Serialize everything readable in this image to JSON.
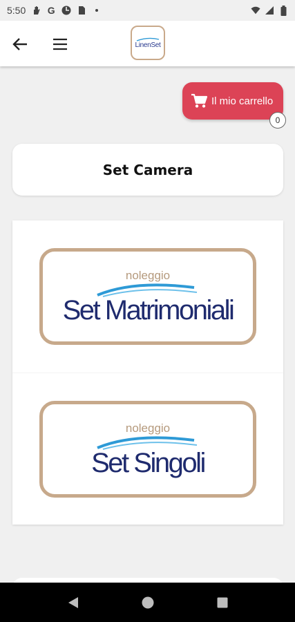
{
  "status_bar": {
    "time": "5:50",
    "left_icons": [
      "hand-icon",
      "google-icon",
      "pinwheel-icon",
      "sim-icon",
      "dot-icon"
    ],
    "right_icons": [
      "wifi-icon",
      "signal-icon",
      "battery-icon"
    ]
  },
  "app_bar": {
    "logo_text": "LinenSet"
  },
  "cart": {
    "label": "Il mio carrello",
    "count": "0"
  },
  "page": {
    "title": "Set Camera"
  },
  "products": [
    {
      "top": "noleggio",
      "name": "Set Matrimoniali"
    },
    {
      "top": "noleggio",
      "name": "Set Singoli"
    }
  ],
  "colors": {
    "cart_bg": "#dc4356",
    "frame": "#c7a98b",
    "text_navy": "#1f2b6e",
    "wave": "#2e9ad6"
  }
}
